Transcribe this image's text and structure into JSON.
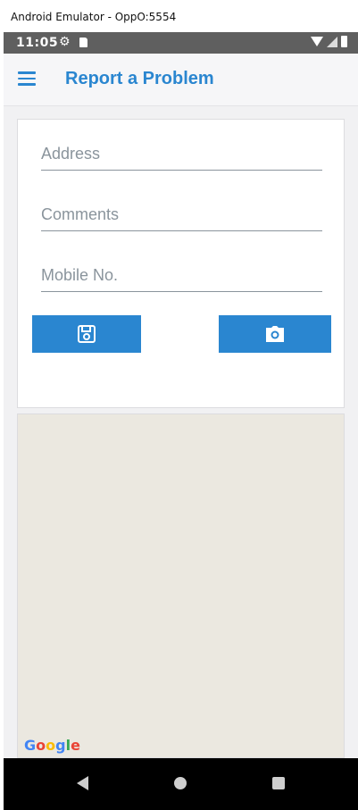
{
  "window": {
    "title": "Android Emulator - OppO:5554"
  },
  "status_bar": {
    "time": "11:05",
    "icons": [
      "gear-icon",
      "sd-card-icon",
      "wifi-icon",
      "signal-icon",
      "battery-icon"
    ]
  },
  "app_bar": {
    "title": "Report a Problem",
    "menu_icon": "hamburger-menu-icon"
  },
  "form": {
    "address": {
      "value": "",
      "placeholder": "Address"
    },
    "comments": {
      "value": "",
      "placeholder": "Comments"
    },
    "mobile": {
      "value": "",
      "placeholder": "Mobile No."
    },
    "save_icon": "floppy-disk-icon",
    "camera_icon": "camera-icon"
  },
  "map": {
    "attribution": "Google"
  },
  "nav_bar": {
    "icons": [
      "back-icon",
      "home-icon",
      "recents-icon"
    ]
  },
  "colors": {
    "accent": "#2a86d0",
    "map_bg": "#ebe8e0",
    "nav_bg": "#000000"
  }
}
